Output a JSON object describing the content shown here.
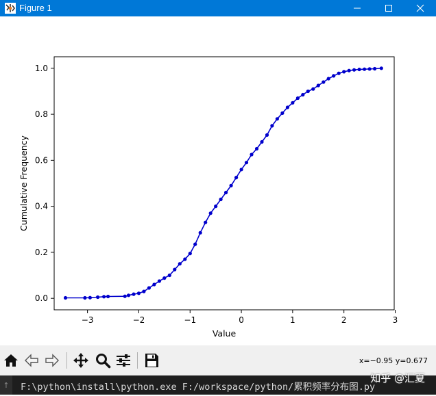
{
  "window": {
    "title": "Figure 1",
    "controls": [
      "minimize-icon",
      "maximize-icon",
      "close-icon"
    ]
  },
  "chart_data": {
    "type": "line",
    "title": "",
    "xlabel": "Value",
    "ylabel": "Cumulative Frequency",
    "xlim": [
      -3.65,
      2.98
    ],
    "ylim": [
      -0.05,
      1.05
    ],
    "xticks": [
      -3,
      -2,
      -1,
      0,
      1,
      2,
      3
    ],
    "xtick_labels": [
      "−3",
      "−2",
      "−1",
      "0",
      "1",
      "2",
      "3"
    ],
    "yticks": [
      0.0,
      0.2,
      0.4,
      0.6,
      0.8,
      1.0
    ],
    "ytick_labels": [
      "0.0",
      "0.2",
      "0.4",
      "0.6",
      "0.8",
      "1.0"
    ],
    "grid": false,
    "marker": "dot",
    "color": "#0000cc",
    "series": [
      {
        "x": [
          -3.43,
          -3.05,
          -2.95,
          -2.8,
          -2.68,
          -2.6,
          -2.27,
          -2.2,
          -2.1,
          -2.0,
          -1.9,
          -1.8,
          -1.7,
          -1.6,
          -1.5,
          -1.4,
          -1.3,
          -1.2,
          -1.1,
          -1.0,
          -0.9,
          -0.8,
          -0.7,
          -0.6,
          -0.5,
          -0.4,
          -0.3,
          -0.2,
          -0.1,
          0.0,
          0.1,
          0.2,
          0.3,
          0.4,
          0.5,
          0.6,
          0.7,
          0.8,
          0.9,
          1.0,
          1.1,
          1.2,
          1.3,
          1.4,
          1.5,
          1.6,
          1.7,
          1.8,
          1.9,
          2.0,
          2.1,
          2.2,
          2.3,
          2.4,
          2.5,
          2.6,
          2.73
        ],
        "y": [
          0.002,
          0.002,
          0.003,
          0.005,
          0.007,
          0.008,
          0.009,
          0.013,
          0.018,
          0.022,
          0.03,
          0.045,
          0.06,
          0.075,
          0.088,
          0.1,
          0.125,
          0.15,
          0.17,
          0.195,
          0.235,
          0.285,
          0.33,
          0.37,
          0.4,
          0.43,
          0.46,
          0.49,
          0.525,
          0.56,
          0.59,
          0.625,
          0.65,
          0.68,
          0.71,
          0.75,
          0.78,
          0.805,
          0.83,
          0.85,
          0.87,
          0.885,
          0.9,
          0.91,
          0.925,
          0.94,
          0.955,
          0.967,
          0.978,
          0.985,
          0.99,
          0.993,
          0.995,
          0.996,
          0.997,
          0.998,
          1.0
        ]
      }
    ]
  },
  "toolbar": {
    "buttons": [
      "home-icon",
      "back-icon",
      "forward-icon",
      "pan-icon",
      "zoom-icon",
      "configure-subplots-icon",
      "save-icon"
    ],
    "coords": "x=−0.95 y=0.677"
  },
  "console": {
    "command": "F:\\python\\install\\python.exe F:/workspace/python/累积频率分布图.py"
  },
  "watermark": "知乎 @汇夏"
}
